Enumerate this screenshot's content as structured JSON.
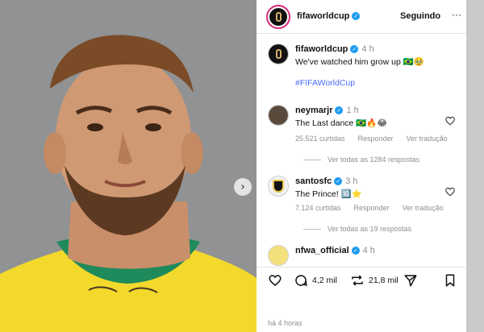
{
  "post": {
    "account": "fifaworldcup",
    "follow_label": "Seguindo",
    "more_label": "···",
    "caption": {
      "author": "fifaworldcup",
      "time": "4 h",
      "text": "We've watched him grow up 🇧🇷🥹",
      "hashtag": "#FIFAWorldCup"
    },
    "carousel_next": "›",
    "posted_ago": "há 4 horas"
  },
  "comments": [
    {
      "author": "neymarjr",
      "time": "1 h",
      "text": "The Last dance 🇧🇷🔥😂",
      "likes": "25.521 curtidas",
      "reply": "Responder",
      "translate": "Ver tradução",
      "view_replies": "Ver todas as 1284 respostas"
    },
    {
      "author": "santosfc",
      "time": "3 h",
      "text": "The Prince! 🔟⭐",
      "likes": "7.124 curtidas",
      "reply": "Responder",
      "translate": "Ver tradução",
      "view_replies": "Ver todas as 19 respostas"
    },
    {
      "author": "nfwa_official",
      "time": "4 h",
      "text": ""
    }
  ],
  "actions": {
    "comments_count": "4,2 mil",
    "reposts_count": "21,8 mil"
  },
  "icons": {
    "verified": "verified-badge-icon",
    "heart": "heart-icon",
    "comment": "comment-icon",
    "repost": "repost-icon",
    "share": "send-icon",
    "save": "bookmark-icon"
  },
  "colors": {
    "verified": "#1d9bf0",
    "hashtag": "#4a6cf7",
    "jersey": "#f4dc2a",
    "collar": "#1f8a5b"
  }
}
